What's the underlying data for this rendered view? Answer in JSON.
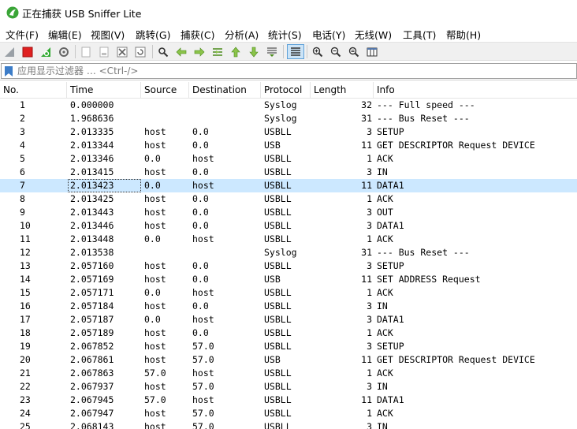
{
  "window": {
    "title": "正在捕获 USB Sniffer Lite"
  },
  "menu": {
    "items": [
      {
        "label": "文件(F)"
      },
      {
        "label": "编辑(E)"
      },
      {
        "label": "视图(V)"
      },
      {
        "label": "跳转(G)"
      },
      {
        "label": "捕获(C)"
      },
      {
        "label": "分析(A)"
      },
      {
        "label": "统计(S)"
      },
      {
        "label": "电话(Y)"
      },
      {
        "label": "无线(W)"
      },
      {
        "label": "工具(T)"
      },
      {
        "label": "帮助(H)"
      }
    ]
  },
  "toolbar": {
    "icons": [
      "shark-fin-start-icon",
      "stop-square-icon",
      "restart-capture-icon",
      "capture-options-gear-icon",
      "open-file-icon",
      "save-file-icon",
      "close-file-icon",
      "reload-icon",
      "find-packet-icon",
      "go-back-icon",
      "go-forward-icon",
      "go-to-packet-icon",
      "go-first-icon",
      "go-last-icon",
      "autoscroll-icon",
      "colorize-icon",
      "zoom-in-icon",
      "zoom-out-icon",
      "zoom-normal-icon",
      "resize-columns-icon"
    ],
    "accent_red": "#e02020",
    "accent_green": "#2fa82f"
  },
  "filter": {
    "placeholder": "应用显示过滤器 … <Ctrl-/>"
  },
  "packet_list": {
    "columns": [
      "No.",
      "Time",
      "Source",
      "Destination",
      "Protocol",
      "Length",
      "Info"
    ],
    "selected_no": "7",
    "rows": [
      {
        "no": "1",
        "time": "0.000000",
        "src": "",
        "dst": "",
        "proto": "Syslog",
        "len": "32",
        "info": "--- Full speed ---"
      },
      {
        "no": "2",
        "time": "1.968636",
        "src": "",
        "dst": "",
        "proto": "Syslog",
        "len": "31",
        "info": "--- Bus Reset ---"
      },
      {
        "no": "3",
        "time": "2.013335",
        "src": "host",
        "dst": "0.0",
        "proto": "USBLL",
        "len": "3",
        "info": "SETUP"
      },
      {
        "no": "4",
        "time": "2.013344",
        "src": "host",
        "dst": "0.0",
        "proto": "USB",
        "len": "11",
        "info": "GET DESCRIPTOR Request DEVICE"
      },
      {
        "no": "5",
        "time": "2.013346",
        "src": "0.0",
        "dst": "host",
        "proto": "USBLL",
        "len": "1",
        "info": "ACK"
      },
      {
        "no": "6",
        "time": "2.013415",
        "src": "host",
        "dst": "0.0",
        "proto": "USBLL",
        "len": "3",
        "info": "IN"
      },
      {
        "no": "7",
        "time": "2.013423",
        "src": "0.0",
        "dst": "host",
        "proto": "USBLL",
        "len": "11",
        "info": "DATA1"
      },
      {
        "no": "8",
        "time": "2.013425",
        "src": "host",
        "dst": "0.0",
        "proto": "USBLL",
        "len": "1",
        "info": "ACK"
      },
      {
        "no": "9",
        "time": "2.013443",
        "src": "host",
        "dst": "0.0",
        "proto": "USBLL",
        "len": "3",
        "info": "OUT"
      },
      {
        "no": "10",
        "time": "2.013446",
        "src": "host",
        "dst": "0.0",
        "proto": "USBLL",
        "len": "3",
        "info": "DATA1"
      },
      {
        "no": "11",
        "time": "2.013448",
        "src": "0.0",
        "dst": "host",
        "proto": "USBLL",
        "len": "1",
        "info": "ACK"
      },
      {
        "no": "12",
        "time": "2.013538",
        "src": "",
        "dst": "",
        "proto": "Syslog",
        "len": "31",
        "info": "--- Bus Reset ---"
      },
      {
        "no": "13",
        "time": "2.057160",
        "src": "host",
        "dst": "0.0",
        "proto": "USBLL",
        "len": "3",
        "info": "SETUP"
      },
      {
        "no": "14",
        "time": "2.057169",
        "src": "host",
        "dst": "0.0",
        "proto": "USB",
        "len": "11",
        "info": "SET ADDRESS Request"
      },
      {
        "no": "15",
        "time": "2.057171",
        "src": "0.0",
        "dst": "host",
        "proto": "USBLL",
        "len": "1",
        "info": "ACK"
      },
      {
        "no": "16",
        "time": "2.057184",
        "src": "host",
        "dst": "0.0",
        "proto": "USBLL",
        "len": "3",
        "info": "IN"
      },
      {
        "no": "17",
        "time": "2.057187",
        "src": "0.0",
        "dst": "host",
        "proto": "USBLL",
        "len": "3",
        "info": "DATA1"
      },
      {
        "no": "18",
        "time": "2.057189",
        "src": "host",
        "dst": "0.0",
        "proto": "USBLL",
        "len": "1",
        "info": "ACK"
      },
      {
        "no": "19",
        "time": "2.067852",
        "src": "host",
        "dst": "57.0",
        "proto": "USBLL",
        "len": "3",
        "info": "SETUP"
      },
      {
        "no": "20",
        "time": "2.067861",
        "src": "host",
        "dst": "57.0",
        "proto": "USB",
        "len": "11",
        "info": "GET DESCRIPTOR Request DEVICE"
      },
      {
        "no": "21",
        "time": "2.067863",
        "src": "57.0",
        "dst": "host",
        "proto": "USBLL",
        "len": "1",
        "info": "ACK"
      },
      {
        "no": "22",
        "time": "2.067937",
        "src": "host",
        "dst": "57.0",
        "proto": "USBLL",
        "len": "3",
        "info": "IN"
      },
      {
        "no": "23",
        "time": "2.067945",
        "src": "57.0",
        "dst": "host",
        "proto": "USBLL",
        "len": "11",
        "info": "DATA1"
      },
      {
        "no": "24",
        "time": "2.067947",
        "src": "host",
        "dst": "57.0",
        "proto": "USBLL",
        "len": "1",
        "info": "ACK"
      },
      {
        "no": "25",
        "time": "2.068143",
        "src": "host",
        "dst": "57.0",
        "proto": "USBLL",
        "len": "3",
        "info": "IN"
      }
    ]
  }
}
